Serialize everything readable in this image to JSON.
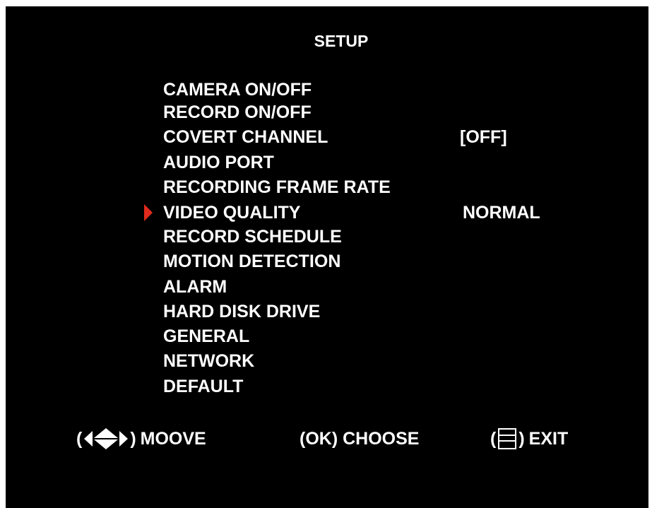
{
  "title": "SETUP",
  "menu": {
    "items": [
      {
        "label": "CAMERA ON/OFF",
        "value": ""
      },
      {
        "label": "RECORD ON/OFF",
        "value": ""
      },
      {
        "label": "COVERT CHANNEL",
        "value": "[OFF]"
      },
      {
        "label": "AUDIO PORT",
        "value": ""
      },
      {
        "label": "RECORDING FRAME RATE",
        "value": ""
      },
      {
        "label": "VIDEO QUALITY",
        "value": "NORMAL"
      },
      {
        "label": "RECORD SCHEDULE",
        "value": ""
      },
      {
        "label": "MOTION DETECTION",
        "value": ""
      },
      {
        "label": "ALARM",
        "value": ""
      },
      {
        "label": "HARD DISK DRIVE",
        "value": ""
      },
      {
        "label": "GENERAL",
        "value": ""
      },
      {
        "label": "NETWORK",
        "value": ""
      },
      {
        "label": "DEFAULT",
        "value": ""
      }
    ],
    "selected_label": "VIDEO QUALITY"
  },
  "footer": {
    "move": {
      "open": "(",
      "close": ")",
      "label": "MOOVE",
      "icon": "arrows-icon"
    },
    "choose": {
      "label": "(OK) CHOOSE"
    },
    "exit": {
      "open": "(",
      "close": ")",
      "label": "EXIT",
      "icon": "menu-icon"
    }
  },
  "colors": {
    "background": "#000000",
    "text": "#ffffff",
    "pointer": "#e02a1c"
  }
}
